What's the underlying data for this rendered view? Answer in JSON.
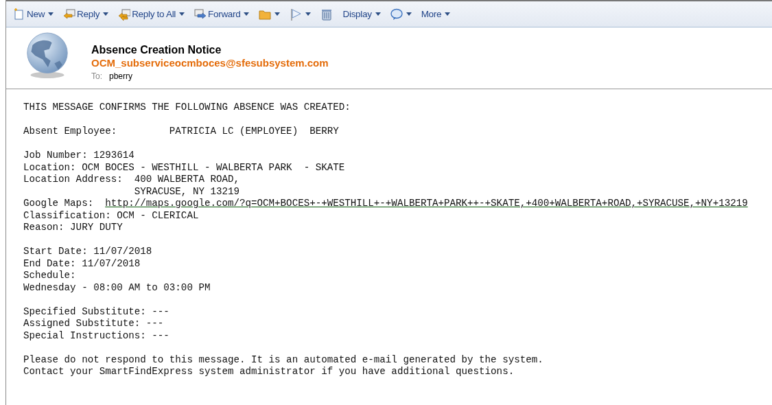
{
  "toolbar": [
    {
      "kind": "new",
      "label": "New",
      "menu": true
    },
    {
      "kind": "reply",
      "label": "Reply",
      "menu": true
    },
    {
      "kind": "reply_all",
      "label": "Reply to All",
      "menu": true
    },
    {
      "kind": "forward",
      "label": "Forward",
      "menu": true
    },
    {
      "kind": "folder",
      "menu": true
    },
    {
      "kind": "flag",
      "menu": true
    },
    {
      "kind": "trash",
      "menu": false
    },
    {
      "kind": "text",
      "label": "Display",
      "menu": true
    },
    {
      "kind": "bubble",
      "menu": true
    },
    {
      "kind": "text",
      "label": "More",
      "menu": true
    }
  ],
  "message": {
    "subject": "Absence Creation Notice",
    "sender": "OCM_subserviceocmboces@sfesubsystem.com",
    "to_label": "To:",
    "to": "pberry",
    "paragraphs": [
      [
        {
          "kind": "text",
          "text": "THIS MESSAGE CONFIRMS THE FOLLOWING ABSENCE WAS CREATED:"
        }
      ],
      [
        {
          "kind": "text",
          "text": "Absent Employee:         PATRICIA LC (EMPLOYEE)  BERRY"
        }
      ],
      [
        {
          "kind": "text",
          "text": "Job Number: 1293614"
        },
        {
          "kind": "text",
          "text": "Location: OCM BOCES - WESTHILL - WALBERTA PARK  - SKATE"
        },
        {
          "kind": "text",
          "text": "Location Address:  400 WALBERTA ROAD,"
        },
        {
          "kind": "indent",
          "text": "SYRACUSE, NY 13219"
        },
        {
          "kind": "link",
          "label": "Google Maps:",
          "url": "http://maps.google.com/?q=OCM+BOCES+-+WESTHILL+-+WALBERTA+PARK++-+SKATE,+400+WALBERTA+ROAD,+SYRACUSE,+NY+13219"
        },
        {
          "kind": "text",
          "text": "Classification: OCM - CLERICAL"
        },
        {
          "kind": "text",
          "text": "Reason: JURY DUTY"
        }
      ],
      [
        {
          "kind": "text",
          "text": "Start Date: 11/07/2018"
        },
        {
          "kind": "text",
          "text": "End Date: 11/07/2018"
        },
        {
          "kind": "text",
          "text": "Schedule:"
        },
        {
          "kind": "text",
          "text": "Wednesday - 08:00 AM to 03:00 PM"
        }
      ],
      [
        {
          "kind": "text",
          "text": "Specified Substitute: ---"
        },
        {
          "kind": "text",
          "text": "Assigned Substitute: ---"
        },
        {
          "kind": "text",
          "text": "Special Instructions: ---"
        }
      ],
      [
        {
          "kind": "text",
          "text": "Please do not respond to this message. It is an automated e-mail generated by the system."
        },
        {
          "kind": "text",
          "text": "Contact your SmartFindExpress system administrator if you have additional questions."
        }
      ]
    ]
  }
}
